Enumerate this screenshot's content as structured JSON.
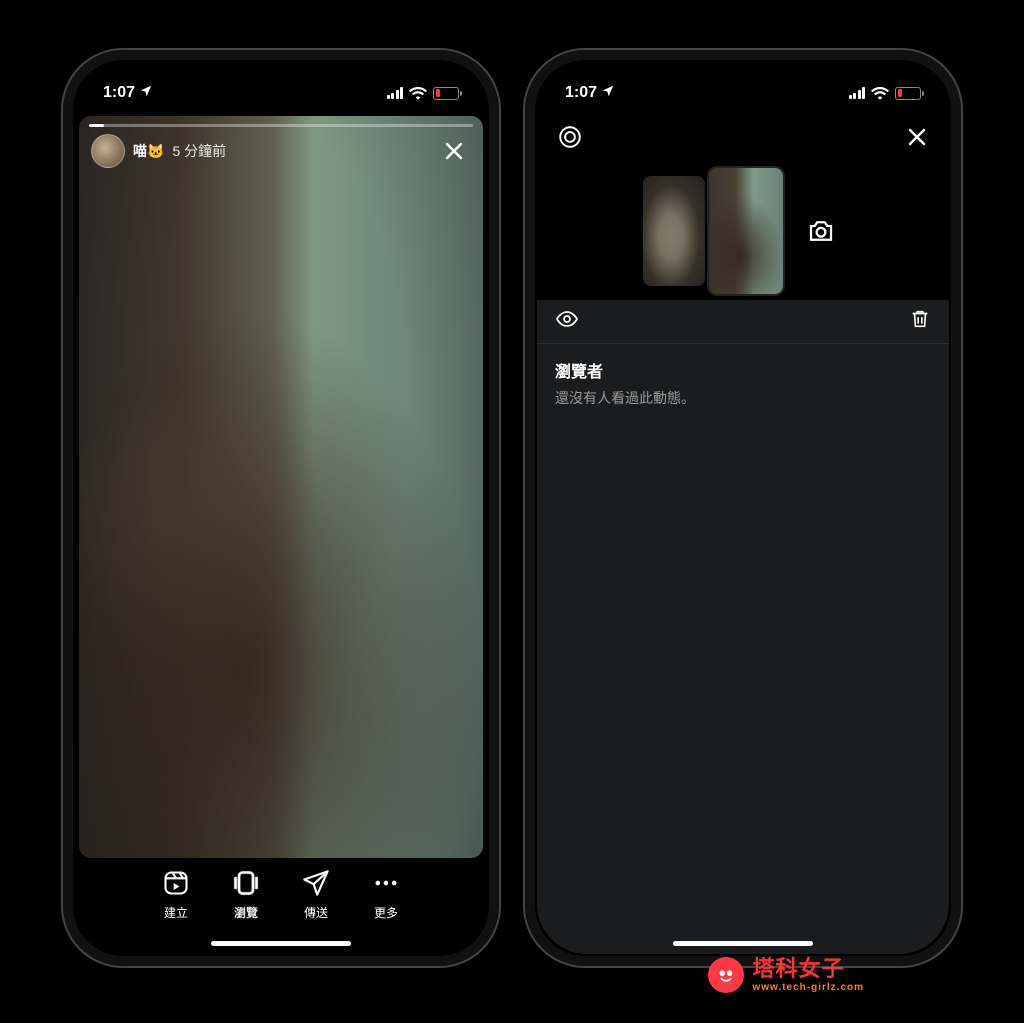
{
  "status": {
    "time": "1:07",
    "location_arrow": true,
    "battery_pct": 15,
    "battery_color": "#ff3b30"
  },
  "left": {
    "story": {
      "username": "喵🐱",
      "time_ago": "5 分鐘前"
    },
    "footer": {
      "create": "建立",
      "browse": "瀏覽",
      "send": "傳送",
      "more": "更多"
    },
    "icons": {
      "close": "close-icon",
      "create": "reels-create-icon",
      "browse": "stack-icon",
      "send": "paper-plane-icon",
      "more": "more-icon"
    }
  },
  "right": {
    "top_icons": {
      "settings": "settings-gear-icon",
      "close": "close-icon",
      "camera": "camera-icon"
    },
    "panel": {
      "viewers_title": "瀏覽者",
      "viewers_empty": "還沒有人看過此動態。",
      "icons": {
        "eye": "eye-icon",
        "trash": "trash-icon"
      }
    },
    "thumbs": [
      {
        "sel": false,
        "kind": "cat-lying"
      },
      {
        "sel": true,
        "kind": "cat-profile"
      }
    ]
  },
  "watermark": {
    "brand_cn": "塔科女子",
    "brand_en": "www.tech-girlz.com"
  }
}
